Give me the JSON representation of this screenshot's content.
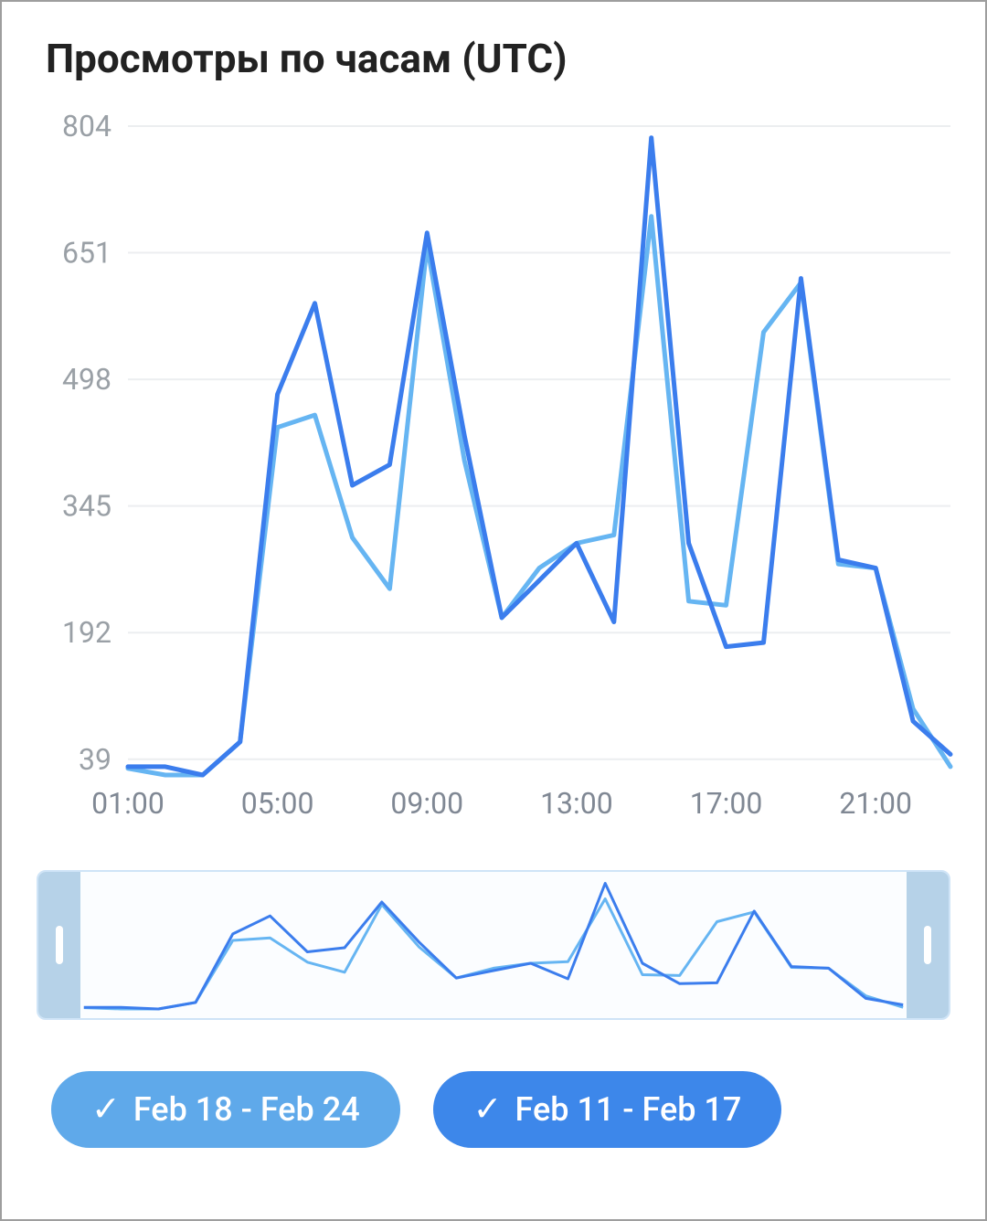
{
  "title": "Просмотры по часам (UTC)",
  "legend": {
    "a": "Feb 18 - Feb 24",
    "b": "Feb 11 - Feb 17"
  },
  "chart_data": {
    "type": "line",
    "title": "Просмотры по часам (UTC)",
    "xlabel": "",
    "ylabel": "",
    "ylim": [
      20,
      804
    ],
    "y_ticks": [
      39,
      192,
      345,
      498,
      651,
      804
    ],
    "x_ticks": [
      "01:00",
      "05:00",
      "09:00",
      "13:00",
      "17:00",
      "21:00"
    ],
    "x": [
      "01:00",
      "02:00",
      "03:00",
      "04:00",
      "05:00",
      "06:00",
      "07:00",
      "08:00",
      "09:00",
      "10:00",
      "11:00",
      "12:00",
      "13:00",
      "14:00",
      "15:00",
      "16:00",
      "17:00",
      "18:00",
      "19:00",
      "20:00",
      "21:00",
      "22:00",
      "23:00"
    ],
    "series": [
      {
        "name": "Feb 18 - Feb 24",
        "color": "#66b5f2",
        "values": [
          28,
          20,
          20,
          60,
          440,
          455,
          307,
          245,
          660,
          400,
          210,
          270,
          300,
          310,
          695,
          230,
          225,
          555,
          615,
          275,
          270,
          100,
          30
        ]
      },
      {
        "name": "Feb 11 - Feb 17",
        "color": "#3b7ded",
        "values": [
          30,
          30,
          20,
          60,
          480,
          590,
          370,
          395,
          675,
          430,
          210,
          255,
          300,
          205,
          790,
          300,
          175,
          180,
          620,
          280,
          270,
          85,
          45
        ]
      }
    ]
  }
}
